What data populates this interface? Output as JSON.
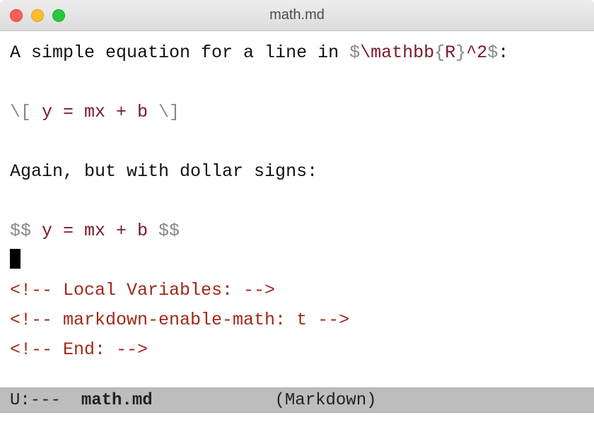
{
  "window": {
    "title": "math.md"
  },
  "buffer": {
    "line1_text_prefix": "A simple equation for a line in ",
    "line1_math_open": "$",
    "line1_math_body": "\\mathbb",
    "line1_math_brace_l": "{",
    "line1_math_brace_c": "R",
    "line1_math_brace_r": "}",
    "line1_math_exp": "^2",
    "line1_math_close": "$",
    "line1_text_suffix": ":",
    "eq_open": "\\[",
    "eq_body": " y = mx + b ",
    "eq_close": "\\]",
    "again": "Again, but with dollar signs:",
    "dd_open": "$$",
    "dd_body": " y = mx + b ",
    "dd_close": "$$",
    "comment1": "<!-- Local Variables: -->",
    "comment2": "<!-- markdown-enable-math: t -->",
    "comment3": "<!-- End: -->"
  },
  "modeline": {
    "left": "U:---  ",
    "buffer": "math.md",
    "gap": "            ",
    "mode": "(Markdown)"
  }
}
